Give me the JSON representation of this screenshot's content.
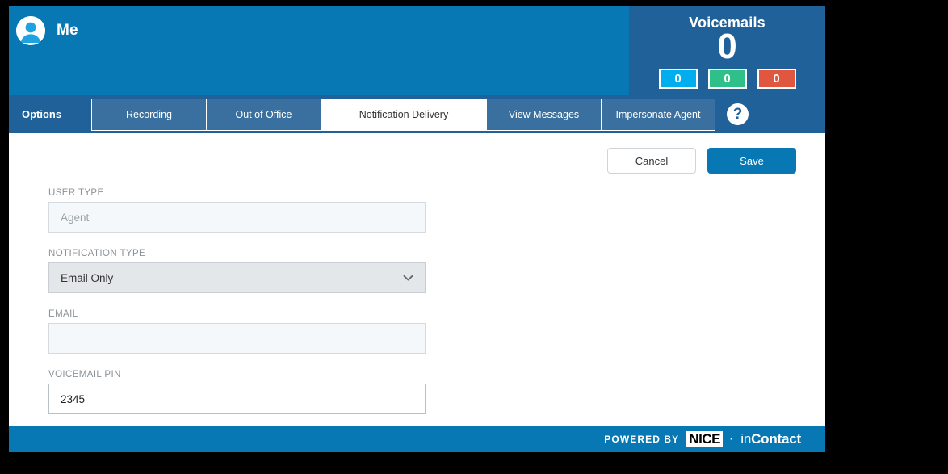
{
  "header": {
    "user_name": "Me",
    "avatar_icon": "user-avatar-icon"
  },
  "voicemails": {
    "title": "Voicemails",
    "total": "0",
    "badges": [
      {
        "label": "0",
        "type": "new",
        "color": "#00AEEF"
      },
      {
        "label": "0",
        "type": "saved",
        "color": "#2FC08A"
      },
      {
        "label": "0",
        "type": "urgent",
        "color": "#E0563F"
      }
    ]
  },
  "tabbar": {
    "options_label": "Options",
    "help_icon": "?",
    "tabs": [
      {
        "label": "Recording",
        "active": false
      },
      {
        "label": "Out of Office",
        "active": false
      },
      {
        "label": "Notification Delivery",
        "active": true
      },
      {
        "label": "View Messages",
        "active": false
      },
      {
        "label": "Impersonate Agent",
        "active": false
      }
    ]
  },
  "actions": {
    "cancel_label": "Cancel",
    "save_label": "Save"
  },
  "form": {
    "user_type": {
      "label": "User Type",
      "value": "Agent"
    },
    "notification_type": {
      "label": "Notification Type",
      "value": "Email Only",
      "chevron": "chevron-down-icon"
    },
    "email": {
      "label": "Email",
      "value": ""
    },
    "voicemail_pin": {
      "label": "Voicemail PIN",
      "value": "2345"
    }
  },
  "footer": {
    "powered_by": "POWERED BY",
    "brand_mark": "NICE",
    "separator": "·",
    "brand_in": "in",
    "brand_contact": "Contact"
  }
}
